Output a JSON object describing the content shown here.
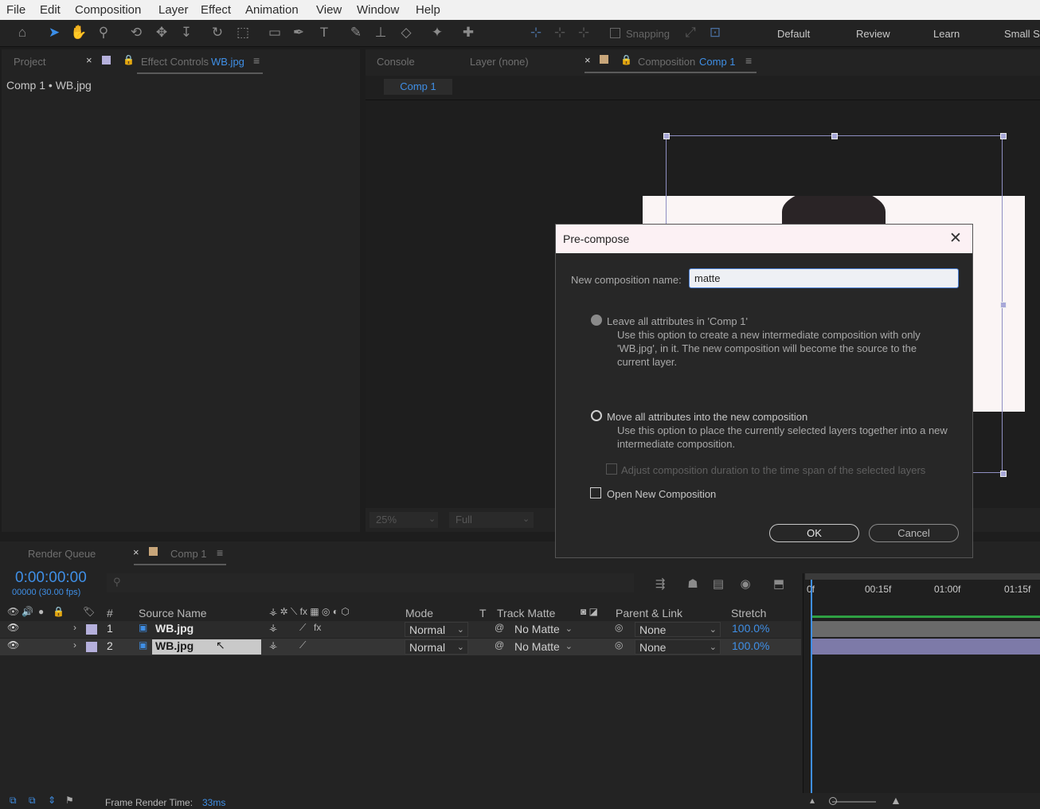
{
  "menu": [
    "File",
    "Edit",
    "Composition",
    "Layer",
    "Effect",
    "Animation",
    "View",
    "Window",
    "Help"
  ],
  "toolbar": {
    "snapping_label": "Snapping",
    "workspaces": [
      "Default",
      "Review",
      "Learn",
      "Small S"
    ]
  },
  "left_panel": {
    "tab_project": "Project",
    "tab_effect_controls": "Effect Controls",
    "tab_effect_controls_target": "WB.jpg",
    "breadcrumb": "Comp 1 • WB.jpg"
  },
  "viewer_panel": {
    "tab_console": "Console",
    "tab_layer": "Layer (none)",
    "tab_composition": "Composition",
    "tab_composition_name": "Comp 1",
    "subtab": "Comp 1",
    "zoom": "25%",
    "resolution": "Full"
  },
  "timeline": {
    "tab_render_queue": "Render Queue",
    "tab_comp": "Comp 1",
    "timecode": "0:00:00:00",
    "frame_info": "00000 (30.00 fps)",
    "headers": {
      "number": "#",
      "source_name": "Source Name",
      "mode": "Mode",
      "t": "T",
      "track_matte": "Track Matte",
      "parent_link": "Parent & Link",
      "stretch": "Stretch"
    },
    "ruler": [
      "0f",
      "00:15f",
      "01:00f",
      "01:15f"
    ],
    "layers": [
      {
        "num": "1",
        "name": "WB.jpg",
        "mode": "Normal",
        "matte": "No Matte",
        "parent": "None",
        "stretch": "100.0%"
      },
      {
        "num": "2",
        "name": "WB.jpg",
        "mode": "Normal",
        "matte": "No Matte",
        "parent": "None",
        "stretch": "100.0%"
      }
    ]
  },
  "status": {
    "frame_render_label": "Frame Render Time:",
    "frame_render_value": "33ms"
  },
  "dialog": {
    "title": "Pre-compose",
    "name_label": "New composition name:",
    "name_value": "matte",
    "option1_label": "Leave all attributes in 'Comp 1'",
    "option1_desc": "Use this option to create a new intermediate composition with only 'WB.jpg', in it. The new composition will become the source to the current layer.",
    "option2_label": "Move all attributes into the new composition",
    "option2_desc": "Use this option to place the currently selected layers together into a new intermediate composition.",
    "adjust_label": "Adjust composition duration to the time span of the selected layers",
    "open_new_label": "Open New Composition",
    "ok_label": "OK",
    "cancel_label": "Cancel"
  },
  "colors": {
    "accent_blue": "#3f8fe6",
    "label_lavender": "#b5b0dc",
    "label_tan": "#c8a67a",
    "work_area_green": "#2ea043"
  }
}
